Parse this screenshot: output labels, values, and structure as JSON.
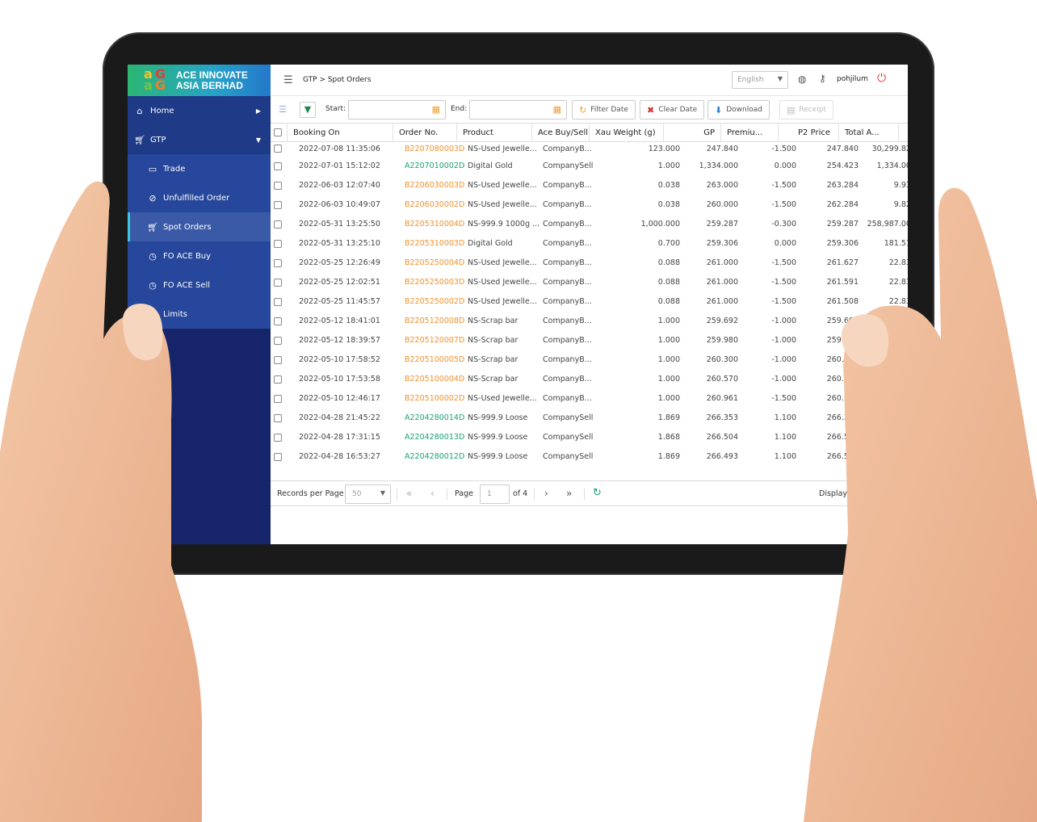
{
  "brand": {
    "line1": "ACE INNOVATE",
    "line2": "ASIA BERHAD"
  },
  "sidebar": {
    "home": "Home",
    "gtp": "GTP",
    "items": [
      {
        "label": "Trade",
        "icon": "monitor-icon"
      },
      {
        "label": "Unfulfilled Order",
        "icon": "ban-icon"
      },
      {
        "label": "Spot Orders",
        "icon": "cart-icon"
      },
      {
        "label": "FO ACE Buy",
        "icon": "clock-icon"
      },
      {
        "label": "FO ACE Sell",
        "icon": "clock-icon"
      },
      {
        "label": "Limits",
        "icon": "clock-icon"
      }
    ]
  },
  "topbar": {
    "breadcrumb": "GTP > Spot Orders",
    "language": "English",
    "username": "pohjilum"
  },
  "toolbar": {
    "start_label": "Start:",
    "end_label": "End:",
    "filter_date": "Filter Date",
    "clear_date": "Clear Date",
    "download": "Download",
    "receipt": "Receipt"
  },
  "table": {
    "columns": [
      "Booking On",
      "Order No.",
      "Product",
      "Ace Buy/Sell",
      "Xau Weight (g)",
      "GP",
      "Premiu...",
      "P2 Price",
      "Total A..."
    ],
    "rows": [
      [
        "2022-07-08 11:35:06",
        "B2207080003D",
        "NS-Used Jewelle...",
        "CompanyB...",
        "123.000",
        "247.840",
        "-1.500",
        "247.840",
        "30,299.820"
      ],
      [
        "2022-07-01 15:12:02",
        "A2207010002D",
        "Digital Gold",
        "CompanySell",
        "1.000",
        "1,334.000",
        "0.000",
        "254.423",
        "1,334.000"
      ],
      [
        "2022-06-03 12:07:40",
        "B2206030003D",
        "NS-Used Jewelle...",
        "CompanyB...",
        "0.038",
        "263.000",
        "-1.500",
        "263.284",
        "9.937"
      ],
      [
        "2022-06-03 10:49:07",
        "B2206030002D",
        "NS-Used Jewelle...",
        "CompanyB...",
        "0.038",
        "260.000",
        "-1.500",
        "262.284",
        "9.823"
      ],
      [
        "2022-05-31 13:25:50",
        "B2205310004D",
        "NS-999.9 1000g ...",
        "CompanyB...",
        "1,000.000",
        "259.287",
        "-0.300",
        "259.287",
        "258,987.000"
      ],
      [
        "2022-05-31 13:25:10",
        "B2205310003D",
        "Digital Gold",
        "CompanyB...",
        "0.700",
        "259.306",
        "0.000",
        "259.306",
        "181.514"
      ],
      [
        "2022-05-25 12:26:49",
        "B2205250004D",
        "NS-Used Jewelle...",
        "CompanyB...",
        "0.088",
        "261.000",
        "-1.500",
        "261.627",
        "22.836"
      ],
      [
        "2022-05-25 12:02:51",
        "B2205250003D",
        "NS-Used Jewelle...",
        "CompanyB...",
        "0.088",
        "261.000",
        "-1.500",
        "261.591",
        "22.836"
      ],
      [
        "2022-05-25 11:45:57",
        "B2205250002D",
        "NS-Used Jewelle...",
        "CompanyB...",
        "0.088",
        "261.000",
        "-1.500",
        "261.508",
        "22.836"
      ],
      [
        "2022-05-12 18:41:01",
        "B2205120008D",
        "NS-Scrap bar",
        "CompanyB...",
        "1.000",
        "259.692",
        "-1.000",
        "259.692",
        "2"
      ],
      [
        "2022-05-12 18:39:57",
        "B2205120007D",
        "NS-Scrap bar",
        "CompanyB...",
        "1.000",
        "259.980",
        "-1.000",
        "259.980",
        ""
      ],
      [
        "2022-05-10 17:58:52",
        "B2205100005D",
        "NS-Scrap bar",
        "CompanyB...",
        "1.000",
        "260.300",
        "-1.000",
        "260.300",
        ""
      ],
      [
        "2022-05-10 17:53:58",
        "B2205100004D",
        "NS-Scrap bar",
        "CompanyB...",
        "1.000",
        "260.570",
        "-1.000",
        "260.570",
        ""
      ],
      [
        "2022-05-10 12:46:17",
        "B2205100002D",
        "NS-Used Jewelle...",
        "CompanyB...",
        "1.000",
        "260.961",
        "-1.500",
        "260.961",
        ""
      ],
      [
        "2022-04-28 21:45:22",
        "A2204280014D",
        "NS-999.9 Loose",
        "CompanySell",
        "1.869",
        "266.353",
        "1.100",
        "266.353",
        ""
      ],
      [
        "2022-04-28 17:31:15",
        "A2204280013D",
        "NS-999.9 Loose",
        "CompanySell",
        "1.868",
        "266.504",
        "1.100",
        "266.504",
        ""
      ],
      [
        "2022-04-28 16:53:27",
        "A2204280012D",
        "NS-999.9 Loose",
        "CompanySell",
        "1.869",
        "266.493",
        "1.100",
        "266.503",
        ""
      ]
    ]
  },
  "pager": {
    "records_label": "Records per Page",
    "records_value": "50",
    "page_label": "Page",
    "page_value": "1",
    "of_label": "of 4",
    "display_label": "Displayi"
  },
  "colors": {
    "order_buy": "#f0902c",
    "order_sell": "#1aa079",
    "sidebar": "#1b2a66",
    "accent": "#3cc8e0"
  }
}
